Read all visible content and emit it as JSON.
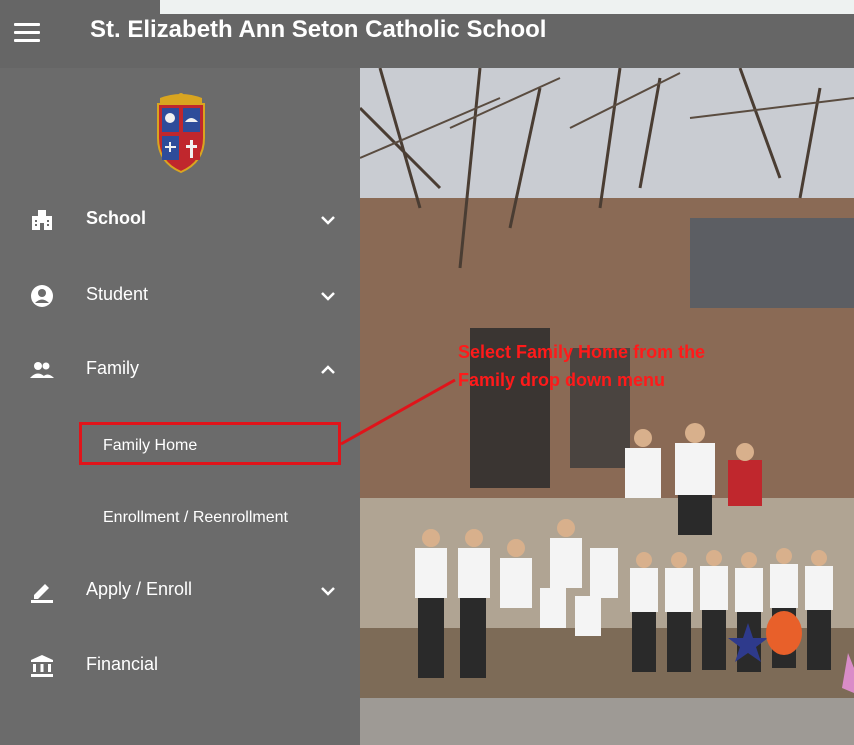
{
  "header": {
    "title": "St. Elizabeth Ann Seton Catholic School",
    "menu_icon": "hamburger-menu-icon"
  },
  "sidebar": {
    "logo": "school-crest-logo",
    "items": [
      {
        "label": "School",
        "icon": "building-icon",
        "expanded": false
      },
      {
        "label": "Student",
        "icon": "user-circle-icon",
        "expanded": false
      },
      {
        "label": "Family",
        "icon": "people-icon",
        "expanded": true
      },
      {
        "label": "Apply / Enroll",
        "icon": "pencil-icon",
        "expanded": false
      },
      {
        "label": "Financial",
        "icon": "bank-icon",
        "expanded": false
      }
    ],
    "family_subitems": [
      "Family Home",
      "Enrollment / Reenrollment"
    ]
  },
  "annotation": {
    "line1": "Select Family Home from the",
    "line2": "Family drop down menu",
    "color": "#ff1a1a"
  },
  "colors": {
    "sidebar_bg": "#6b6b6b",
    "header_bg": "#666666",
    "highlight": "#e0141a"
  }
}
